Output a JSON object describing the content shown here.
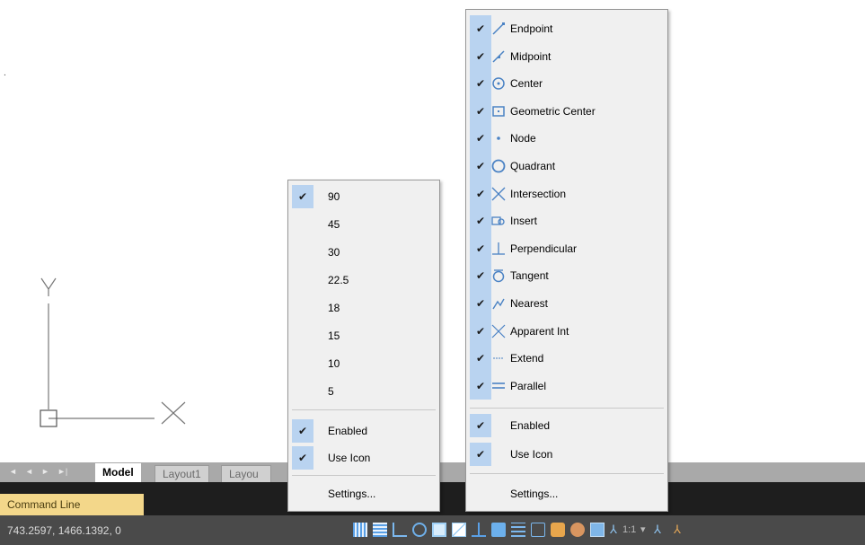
{
  "ucs": {
    "y_label": "Y",
    "x_label": "X"
  },
  "tabs": {
    "nav": [
      "◄",
      "◄",
      "►",
      "►|"
    ],
    "items": [
      {
        "label": "Model",
        "active": true
      },
      {
        "label": "Layout1",
        "active": false
      },
      {
        "label": "Layou",
        "active": false
      }
    ]
  },
  "command_line": {
    "label": "Command Line"
  },
  "status": {
    "coords": "743.2597, 1466.1392, 0",
    "scale": "1:1"
  },
  "angle_menu": {
    "items": [
      {
        "label": "90",
        "checked": true
      },
      {
        "label": "45",
        "checked": false
      },
      {
        "label": "30",
        "checked": false
      },
      {
        "label": "22.5",
        "checked": false
      },
      {
        "label": "18",
        "checked": false
      },
      {
        "label": "15",
        "checked": false
      },
      {
        "label": "10",
        "checked": false
      },
      {
        "label": "5",
        "checked": false
      }
    ],
    "enabled": "Enabled",
    "use_icon": "Use Icon",
    "settings": "Settings..."
  },
  "snap_menu": {
    "items": [
      {
        "label": "Endpoint",
        "icon": "endpoint-icon"
      },
      {
        "label": "Midpoint",
        "icon": "midpoint-icon"
      },
      {
        "label": "Center",
        "icon": "center-icon"
      },
      {
        "label": "Geometric Center",
        "icon": "geometric-center-icon"
      },
      {
        "label": "Node",
        "icon": "node-icon"
      },
      {
        "label": "Quadrant",
        "icon": "quadrant-icon"
      },
      {
        "label": "Intersection",
        "icon": "intersection-icon"
      },
      {
        "label": "Insert",
        "icon": "insert-icon"
      },
      {
        "label": "Perpendicular",
        "icon": "perpendicular-icon"
      },
      {
        "label": "Tangent",
        "icon": "tangent-icon"
      },
      {
        "label": "Nearest",
        "icon": "nearest-icon"
      },
      {
        "label": "Apparent Int",
        "icon": "apparent-int-icon"
      },
      {
        "label": "Extend",
        "icon": "extend-icon"
      },
      {
        "label": "Parallel",
        "icon": "parallel-icon"
      }
    ],
    "enabled": "Enabled",
    "use_icon": "Use Icon",
    "settings": "Settings..."
  },
  "colors": {
    "accent": "#b9d3f0",
    "command_tab": "#f3d78a",
    "status_bg": "#4a4a4a"
  }
}
